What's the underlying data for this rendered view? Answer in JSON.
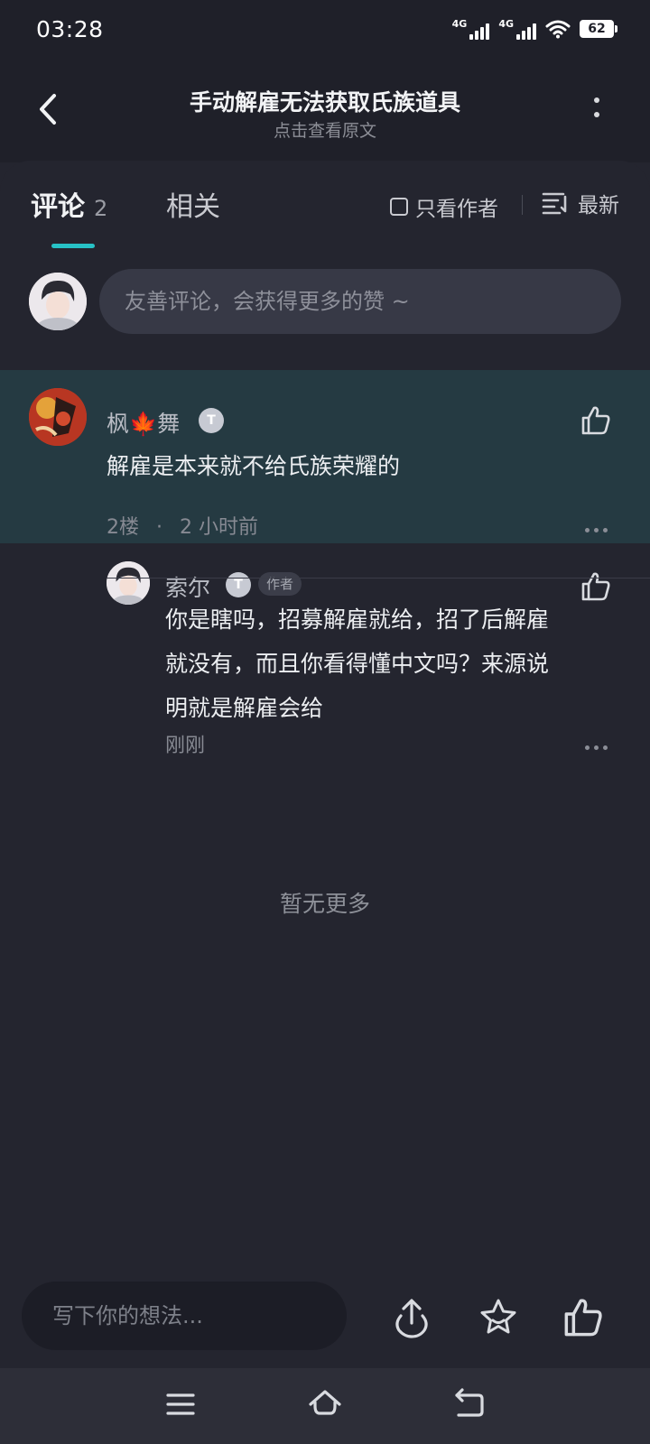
{
  "status_bar": {
    "time": "03:28",
    "network1": "4G",
    "network2": "4G",
    "battery": "62"
  },
  "header": {
    "title": "手动解雇无法获取氏族道具",
    "subtitle": "点击查看原文"
  },
  "tabs": {
    "comments_label": "评论",
    "comments_count": "2",
    "related_label": "相关",
    "author_only_label": "只看作者",
    "sort_label": "最新"
  },
  "comment_input": {
    "placeholder": "友善评论，会获得更多的赞 ~"
  },
  "comments": [
    {
      "user": "枫🍁舞",
      "badge": "T",
      "text": "解雇是本来就不给氏族荣耀的",
      "floor": "2楼",
      "separator": "·",
      "time": "2 小时前"
    }
  ],
  "reply": {
    "user": "索尔",
    "badge": "T",
    "tag": "作者",
    "lines": [
      "你是瞎吗，招募解雇就给，招了后解雇",
      "就没有，而且你看得懂中文吗？来源说",
      "明就是解雇会给"
    ],
    "time": "刚刚"
  },
  "no_more": "暂无更多",
  "bottom_bar": {
    "placeholder": "写下你的想法..."
  },
  "colors": {
    "accent": "#27c2c6",
    "background": "#24252f",
    "highlight": "#253a42"
  }
}
